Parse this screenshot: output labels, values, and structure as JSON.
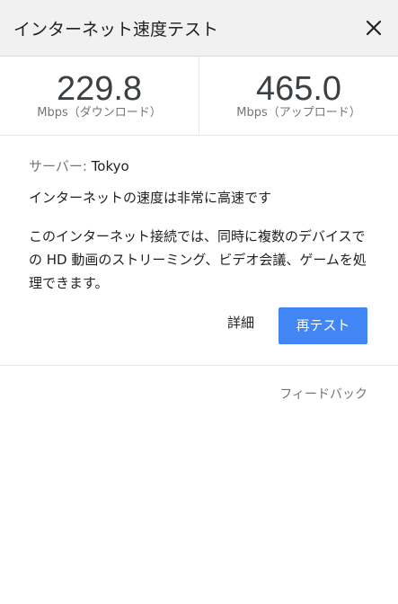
{
  "header": {
    "title": "インターネット速度テスト",
    "close_icon": "close-icon"
  },
  "results": {
    "download": {
      "value": "229.8",
      "unit": "Mbps（ダウンロード）"
    },
    "upload": {
      "value": "465.0",
      "unit": "Mbps（アップロード）"
    }
  },
  "info": {
    "server_label": "サーバー:",
    "server_value": "Tokyo",
    "rating": "インターネットの速度は非常に高速です",
    "description": "このインターネット接続では、同時に複数のデバイスでの HD 動画のストリーミング、ビデオ会議、ゲームを処理できます。"
  },
  "actions": {
    "details_label": "詳細",
    "retest_label": "再テスト"
  },
  "footer": {
    "feedback_label": "フィードバック"
  },
  "colors": {
    "accent": "#4285f4",
    "header_bg": "#f1f1f1",
    "muted_text": "#70757a"
  }
}
